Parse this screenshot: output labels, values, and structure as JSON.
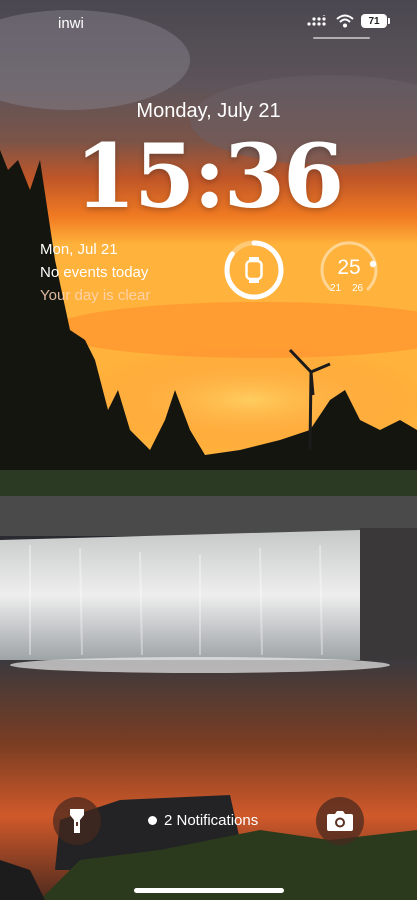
{
  "status": {
    "carrier": "inwi",
    "battery": "71",
    "icons": [
      "signal-dots-icon",
      "wifi-icon",
      "battery-icon"
    ]
  },
  "lockscreen": {
    "date": "Monday, July 21",
    "time": "15:36"
  },
  "calendar_widget": {
    "date": "Mon, Jul 21",
    "events": "No events today",
    "subtitle": "Your day is clear"
  },
  "watch_widget": {
    "icon": "watch-icon",
    "battery_level": 0.85
  },
  "weather_widget": {
    "temperature": "25",
    "low": "21",
    "high": "26"
  },
  "bottom": {
    "flashlight_icon": "flashlight-icon",
    "camera_icon": "camera-icon",
    "notifications": "2 Notifications"
  },
  "colors": {
    "sky_top": "#4b4850",
    "sunset_orange": "#ef6a1d",
    "sunset_glow": "#ffb13a",
    "button_bg": "#46281e"
  }
}
